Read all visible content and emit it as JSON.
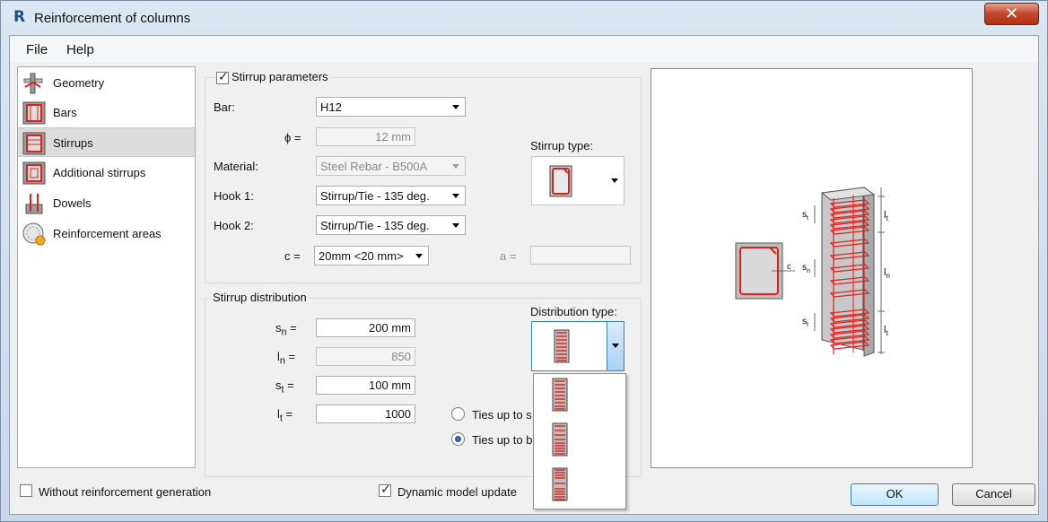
{
  "window": {
    "title": "Reinforcement of columns",
    "close_glyph": "✕"
  },
  "menu": [
    "File",
    "Help"
  ],
  "nav": [
    {
      "label": "Geometry",
      "icon": "geometry-icon"
    },
    {
      "label": "Bars",
      "icon": "bars-icon"
    },
    {
      "label": "Stirrups",
      "icon": "stirrups-icon",
      "selected": true
    },
    {
      "label": "Additional stirrups",
      "icon": "additional-stirrups-icon"
    },
    {
      "label": "Dowels",
      "icon": "dowels-icon"
    },
    {
      "label": "Reinforcement areas",
      "icon": "reinforcement-areas-icon"
    }
  ],
  "stirrup_params": {
    "group_label": "Stirrup parameters",
    "checked": true,
    "bar_label": "Bar:",
    "bar_value": "H12",
    "phi_label": "ϕ =",
    "phi_value": "12 mm",
    "material_label": "Material:",
    "material_value": "Steel Rebar - B500A",
    "hook1_label": "Hook 1:",
    "hook1_value": "Stirrup/Tie - 135 deg.",
    "hook2_label": "Hook 2:",
    "hook2_value": "Stirrup/Tie - 135 deg.",
    "c_label": "c =",
    "c_value": "20mm <20 mm>",
    "a_label": "a =",
    "a_value": "",
    "stirrup_type_label": "Stirrup type:"
  },
  "distribution": {
    "group_label": "Stirrup distribution",
    "sn_label": "s",
    "sn_sub": "n",
    "sn_value": "200 mm",
    "ln_label": "l",
    "ln_sub": "n",
    "ln_value": "850",
    "st_label": "s",
    "st_sub": "t",
    "st_value": "100 mm",
    "lt_label": "l",
    "lt_sub": "t",
    "lt_value": "1000",
    "eq": "=",
    "ties_option1": "Ties up to s",
    "ties_option2": "Ties up to b",
    "ties_selected": 2,
    "distribution_type_label": "Distribution type:"
  },
  "drawing": {
    "labels": {
      "st": "s",
      "st_sub": "t",
      "sn": "s",
      "sn_sub": "n",
      "lt": "l",
      "lt_sub": "t",
      "ln": "l",
      "ln_sub": "n",
      "c": "c"
    }
  },
  "footer": {
    "without_generation_label": "Without reinforcement generation",
    "without_generation_checked": false,
    "dynamic_update_label": "Dynamic model update",
    "dynamic_update_checked": true,
    "ok_label": "OK",
    "cancel_label": "Cancel"
  },
  "colors": {
    "rebar_red": "#e0201c",
    "concrete_gray": "#bdbdbd"
  }
}
